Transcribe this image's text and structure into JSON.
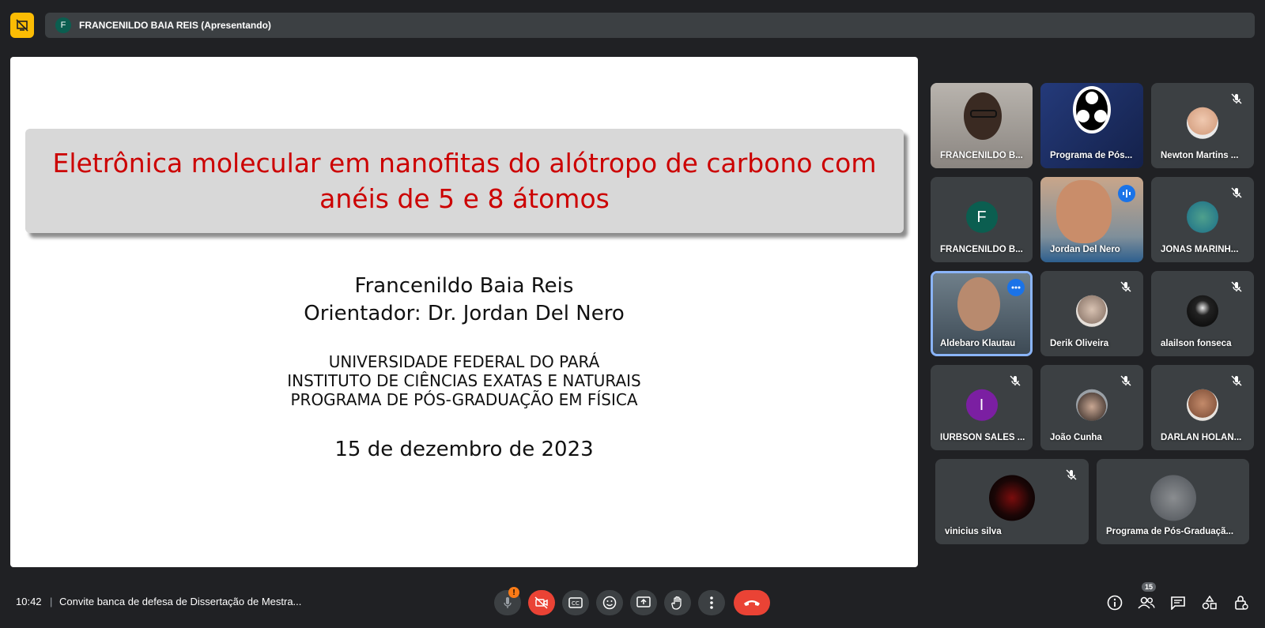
{
  "presenter_bar": {
    "avatar_letter": "F",
    "label": "FRANCENILDO BAIA REIS (Apresentando)"
  },
  "slide": {
    "title": "Eletrônica molecular em nanofitas do alótropo de carbono com anéis de 5 e 8 átomos",
    "author": "Francenildo Baia Reis",
    "advisor": "Orientador:  Dr. Jordan Del Nero",
    "institution_lines": [
      "UNIVERSIDADE FEDERAL DO PARÁ",
      "INSTITUTO DE CIÊNCIAS EXATAS E NATURAIS",
      "PROGRAMA DE PÓS-GRADUAÇÃO EM FÍSICA"
    ],
    "date": "15 de dezembro de 2023"
  },
  "participants": [
    {
      "name": "FRANCENILDO B..."
    },
    {
      "name": "Programa de Pós..."
    },
    {
      "name": "Newton Martins ..."
    },
    {
      "name": "FRANCENILDO B...",
      "avatar_letter": "F"
    },
    {
      "name": "Jordan Del Nero"
    },
    {
      "name": "JONAS MARINH..."
    },
    {
      "name": "Aldebaro Klautau"
    },
    {
      "name": "Derik Oliveira"
    },
    {
      "name": "alailson fonseca"
    },
    {
      "name": "IURBSON SALES ...",
      "avatar_letter": "I"
    },
    {
      "name": "João Cunha"
    },
    {
      "name": "DARLAN HOLAN..."
    },
    {
      "name": "vinicius silva"
    },
    {
      "name": "Programa de Pós-Graduaçã..."
    }
  ],
  "colors": {
    "accent": "#1a73e8",
    "end_call": "#ea4335",
    "presenting": "#fbbc04",
    "tile_bg": "#3c4043"
  },
  "bottom_bar": {
    "time": "10:42",
    "separator": "|",
    "meeting_title": "Convite banca de defesa de Dissertação de Mestra...",
    "mic_warning": "!",
    "people_count": "15"
  }
}
